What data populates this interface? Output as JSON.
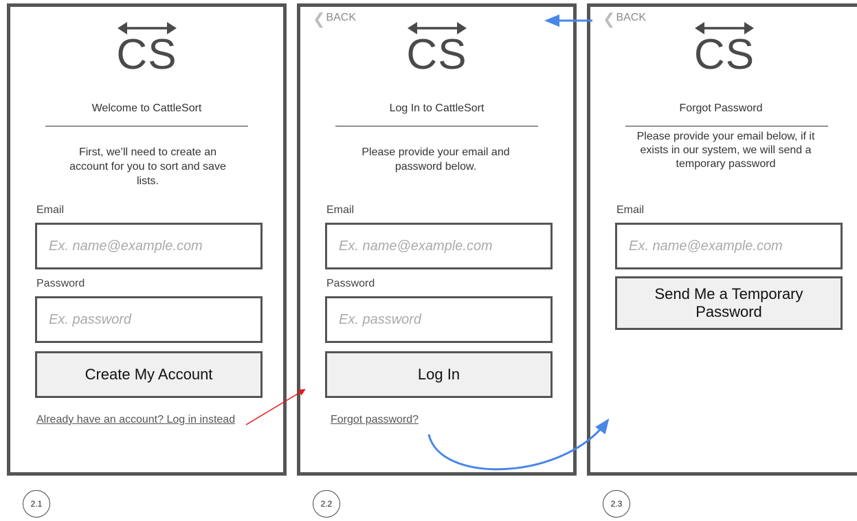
{
  "logo_text": "CS",
  "back_label": "BACK",
  "screens": [
    {
      "title": "Welcome to CattleSort",
      "description": "First, we’ll need to create an account for you to sort and save lists.",
      "email_label": "Email",
      "email_placeholder": "Ex. name@example.com",
      "password_label": "Password",
      "password_placeholder": "Ex. password",
      "button_label": "Create My Account",
      "link_label": "Already have an account? Log in instead",
      "badge": "2.1"
    },
    {
      "title": "Log In to CattleSort",
      "description": "Please provide your email and password below.",
      "email_label": "Email",
      "email_placeholder": "Ex. name@example.com",
      "password_label": "Password",
      "password_placeholder": "Ex. password",
      "button_label": "Log In",
      "link_label": "Forgot password?",
      "badge": "2.2"
    },
    {
      "title": "Forgot Password",
      "description": "Please provide your email below, if it exists in our system, we will send a temporary password",
      "email_label": "Email",
      "email_placeholder": "Ex. name@example.com",
      "button_label": "Send Me a Temporary Password",
      "badge": "2.3"
    }
  ],
  "colors": {
    "frame": "#555555",
    "button_fill": "#f0f0f0",
    "placeholder": "#aaaaaa",
    "arrow_red": "#e8191b",
    "arrow_blue": "#4a86e8"
  },
  "icons": [
    "double-arrow-icon",
    "chevron-left-icon"
  ]
}
